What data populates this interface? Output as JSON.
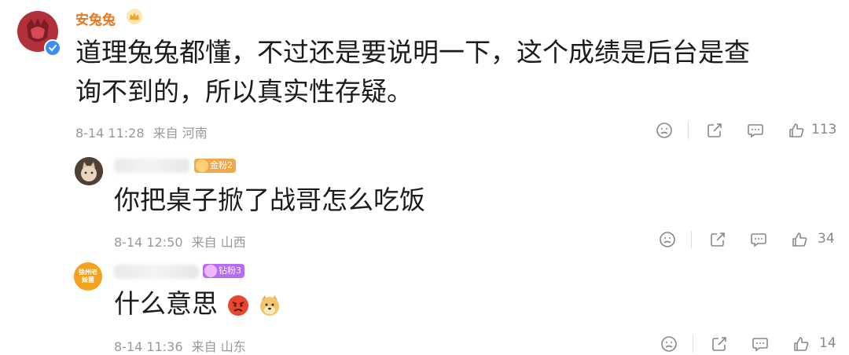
{
  "comments": [
    {
      "author": "安兔兔",
      "text": "道理兔兔都懂，不过还是要说明一下，这个成绩是后台是查询不到的，所以真实性存疑。",
      "line1": "道理兔兔都懂，不过还是要说明一下，这个成绩是后台是查",
      "line2": "询不到的，所以真实性存疑。",
      "time": "8-14 11:28",
      "source": "来自 河南",
      "likes": "113",
      "verified": true
    },
    {
      "author_visible": "",
      "badge": "金粉2",
      "text": "你把桌子掀了战哥怎么吃饭",
      "time": "8-14 12:50",
      "source": "来自 山西",
      "likes": "34"
    },
    {
      "avatar_text": "徐州老妹菌",
      "badge": "钻粉3",
      "text": "什么意思",
      "emojis": [
        "angry-face-icon",
        "doge-icon"
      ],
      "time": "8-14 11:36",
      "source": "来自 山东",
      "likes": "14"
    }
  ],
  "colors": {
    "author": "#e8771e",
    "meta": "#999999",
    "gold_badge": "#f2a74a",
    "diamond_badge": "#b56cf2",
    "avatar_red": "#b2303a"
  }
}
